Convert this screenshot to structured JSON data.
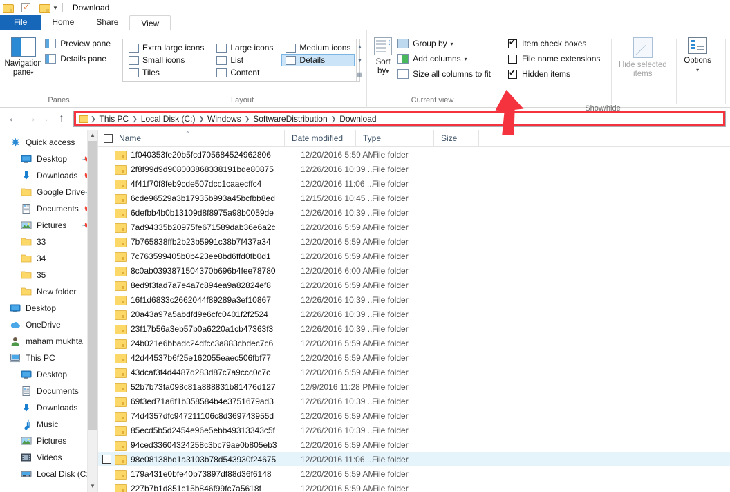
{
  "window": {
    "title": "Download",
    "titlebar_icons": [
      "folder-icon",
      "properties-icon",
      "folder-icon",
      "dropdown-caret-icon"
    ]
  },
  "tabs": [
    {
      "label": "File",
      "kind": "file"
    },
    {
      "label": "Home",
      "kind": "normal"
    },
    {
      "label": "Share",
      "kind": "normal"
    },
    {
      "label": "View",
      "kind": "active"
    }
  ],
  "ribbon": {
    "groups": [
      {
        "label": "Panes"
      },
      {
        "label": "Layout"
      },
      {
        "label": "Current view"
      },
      {
        "label": "Show/hide"
      }
    ],
    "panes": {
      "navigation_pane": "Navigation\npane",
      "navigation_pane_line1": "Navigation",
      "navigation_pane_line2": "pane",
      "preview_pane": "Preview pane",
      "details_pane": "Details pane"
    },
    "layout": {
      "items": [
        {
          "label": "Extra large icons",
          "selected": false
        },
        {
          "label": "Large icons",
          "selected": false
        },
        {
          "label": "Medium icons",
          "selected": false
        },
        {
          "label": "Small icons",
          "selected": false
        },
        {
          "label": "List",
          "selected": false
        },
        {
          "label": "Details",
          "selected": true
        },
        {
          "label": "Tiles",
          "selected": false
        },
        {
          "label": "Content",
          "selected": false
        }
      ]
    },
    "current_view": {
      "sort_by_line1": "Sort",
      "sort_by_line2": "by",
      "group_by": "Group by",
      "add_columns": "Add columns",
      "size_all_columns": "Size all columns to fit"
    },
    "show_hide": {
      "item_check_boxes": {
        "label": "Item check boxes",
        "checked": true
      },
      "file_name_extensions": {
        "label": "File name extensions",
        "checked": false
      },
      "hidden_items": {
        "label": "Hidden items",
        "checked": true
      },
      "hide_selected_items_line1": "Hide selected",
      "hide_selected_items_line2": "items",
      "hide_selected_disabled": true,
      "options": "Options"
    }
  },
  "annotation": {
    "color": "#f5333f",
    "target": "Hidden items checkbox"
  },
  "addressbar": {
    "back": "←",
    "forward": "→",
    "recent": "⌄",
    "up": "↑",
    "crumbs": [
      "This PC",
      "Local Disk (C:)",
      "Windows",
      "SoftwareDistribution",
      "Download"
    ],
    "highlight_color": "#f5333f"
  },
  "sidebar": {
    "items": [
      {
        "label": "Quick access",
        "icon": "star-icon",
        "indent": 0,
        "pinned": false
      },
      {
        "label": "Desktop",
        "icon": "monitor-icon",
        "indent": 1,
        "pinned": true
      },
      {
        "label": "Downloads",
        "icon": "download-arrow-icon",
        "indent": 1,
        "pinned": true
      },
      {
        "label": "Google Drive",
        "icon": "folder-icon",
        "indent": 1,
        "pinned": true
      },
      {
        "label": "Documents",
        "icon": "documents-icon",
        "indent": 1,
        "pinned": true
      },
      {
        "label": "Pictures",
        "icon": "pictures-icon",
        "indent": 1,
        "pinned": true
      },
      {
        "label": "33",
        "icon": "folder-icon",
        "indent": 1,
        "pinned": false
      },
      {
        "label": "34",
        "icon": "folder-icon",
        "indent": 1,
        "pinned": false
      },
      {
        "label": "35",
        "icon": "folder-icon",
        "indent": 1,
        "pinned": false
      },
      {
        "label": "New folder",
        "icon": "folder-icon",
        "indent": 1,
        "pinned": false
      },
      {
        "label": "Desktop",
        "icon": "monitor-icon",
        "indent": 0,
        "pinned": false
      },
      {
        "label": "OneDrive",
        "icon": "cloud-icon",
        "indent": 0,
        "pinned": false
      },
      {
        "label": "maham mukhta",
        "icon": "user-icon",
        "indent": 0,
        "pinned": false
      },
      {
        "label": "This PC",
        "icon": "pc-icon",
        "indent": 0,
        "pinned": false
      },
      {
        "label": "Desktop",
        "icon": "monitor-icon",
        "indent": 1,
        "pinned": false
      },
      {
        "label": "Documents",
        "icon": "documents-icon",
        "indent": 1,
        "pinned": false
      },
      {
        "label": "Downloads",
        "icon": "download-arrow-icon",
        "indent": 1,
        "pinned": false
      },
      {
        "label": "Music",
        "icon": "music-note-icon",
        "indent": 1,
        "pinned": false
      },
      {
        "label": "Pictures",
        "icon": "pictures-icon",
        "indent": 1,
        "pinned": false
      },
      {
        "label": "Videos",
        "icon": "video-icon",
        "indent": 1,
        "pinned": false
      },
      {
        "label": "Local Disk (C:)",
        "icon": "drive-icon",
        "indent": 1,
        "pinned": false
      }
    ]
  },
  "filelist": {
    "columns": [
      "Name",
      "Date modified",
      "Type",
      "Size"
    ],
    "sorted_column": "Name",
    "sort_direction": "ascending",
    "rows": [
      {
        "name": "1f040353fe20b5fcd705684524962806",
        "date": "12/20/2016 5:59 AM",
        "type": "File folder",
        "size": "",
        "selected": false
      },
      {
        "name": "2f8f99d9d908003868338191bde80875",
        "date": "12/26/2016 10:39 ...",
        "type": "File folder",
        "size": "",
        "selected": false
      },
      {
        "name": "4f41f70f8feb9cde507dcc1caaecffc4",
        "date": "12/20/2016 11:06 ...",
        "type": "File folder",
        "size": "",
        "selected": false
      },
      {
        "name": "6cde96529a3b17935b993a45bcfbb8ed",
        "date": "12/15/2016 10:45 ...",
        "type": "File folder",
        "size": "",
        "selected": false
      },
      {
        "name": "6defbb4b0b13109d8f8975a98b0059de",
        "date": "12/26/2016 10:39 ...",
        "type": "File folder",
        "size": "",
        "selected": false
      },
      {
        "name": "7ad94335b20975fe671589dab36e6a2c",
        "date": "12/20/2016 5:59 AM",
        "type": "File folder",
        "size": "",
        "selected": false
      },
      {
        "name": "7b765838ffb2b23b5991c38b7f437a34",
        "date": "12/20/2016 5:59 AM",
        "type": "File folder",
        "size": "",
        "selected": false
      },
      {
        "name": "7c763599405b0b423ee8bd6ffd0fb0d1",
        "date": "12/20/2016 5:59 AM",
        "type": "File folder",
        "size": "",
        "selected": false
      },
      {
        "name": "8c0ab0393871504370b696b4fee78780",
        "date": "12/20/2016 6:00 AM",
        "type": "File folder",
        "size": "",
        "selected": false
      },
      {
        "name": "8ed9f3fad7a7e4a7c894ea9a82824ef8",
        "date": "12/20/2016 5:59 AM",
        "type": "File folder",
        "size": "",
        "selected": false
      },
      {
        "name": "16f1d6833c2662044f89289a3ef10867",
        "date": "12/26/2016 10:39 ...",
        "type": "File folder",
        "size": "",
        "selected": false
      },
      {
        "name": "20a43a97a5abdfd9e6cfc0401f2f2524",
        "date": "12/26/2016 10:39 ...",
        "type": "File folder",
        "size": "",
        "selected": false
      },
      {
        "name": "23f17b56a3eb57b0a6220a1cb47363f3",
        "date": "12/26/2016 10:39 ...",
        "type": "File folder",
        "size": "",
        "selected": false
      },
      {
        "name": "24b021e6bbadc24dfcc3a883cbdec7c6",
        "date": "12/20/2016 5:59 AM",
        "type": "File folder",
        "size": "",
        "selected": false
      },
      {
        "name": "42d44537b6f25e162055eaec506fbf77",
        "date": "12/20/2016 5:59 AM",
        "type": "File folder",
        "size": "",
        "selected": false
      },
      {
        "name": "43dcaf3f4d4487d283d87c7a9ccc0c7c",
        "date": "12/20/2016 5:59 AM",
        "type": "File folder",
        "size": "",
        "selected": false
      },
      {
        "name": "52b7b73fa098c81a888831b81476d127",
        "date": "12/9/2016 11:28 PM",
        "type": "File folder",
        "size": "",
        "selected": false
      },
      {
        "name": "69f3ed71a6f1b358584b4e3751679ad3",
        "date": "12/26/2016 10:39 ...",
        "type": "File folder",
        "size": "",
        "selected": false
      },
      {
        "name": "74d4357dfc947211106c8d369743955d",
        "date": "12/20/2016 5:59 AM",
        "type": "File folder",
        "size": "",
        "selected": false
      },
      {
        "name": "85ecd5b5d2454e96e5ebb49313343c5f",
        "date": "12/26/2016 10:39 ...",
        "type": "File folder",
        "size": "",
        "selected": false
      },
      {
        "name": "94ced33604324258c3bc79ae0b805eb3",
        "date": "12/20/2016 5:59 AM",
        "type": "File folder",
        "size": "",
        "selected": false
      },
      {
        "name": "98e08138bd1a3103b78d543930f24675",
        "date": "12/20/2016 11:06 ...",
        "type": "File folder",
        "size": "",
        "selected": true
      },
      {
        "name": "179a431e0bfe40b73897df88d36f6148",
        "date": "12/20/2016 5:59 AM",
        "type": "File folder",
        "size": "",
        "selected": false
      },
      {
        "name": "227b7b1d851c15b846f99fc7a5618f",
        "date": "12/20/2016 5:59 AM",
        "type": "File folder",
        "size": "",
        "selected": false
      }
    ]
  }
}
